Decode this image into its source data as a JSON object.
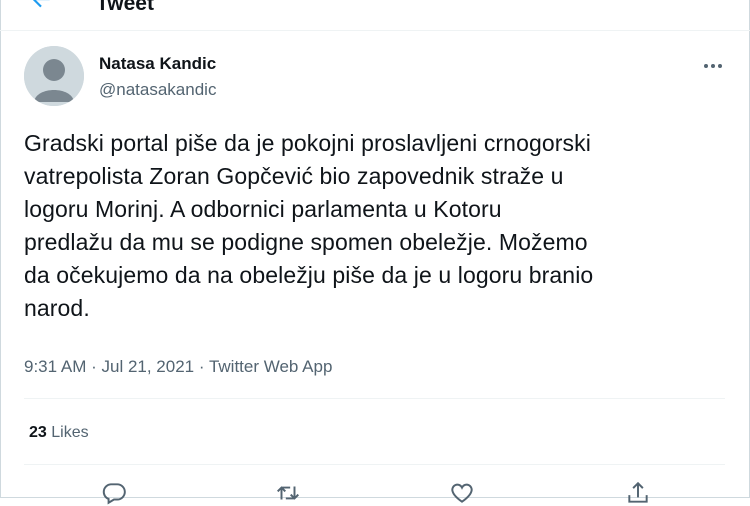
{
  "header": {
    "title": "Tweet"
  },
  "author": {
    "name": "Natasa Kandic",
    "handle": "@natasakandic"
  },
  "tweet": {
    "text": "Gradski portal piše da je pokojni proslavljeni crnogorski\nvatrepolista Zoran Gopčević bio zapovednik straže u\nlogoru Morinj. A odbornici parlamenta u Kotoru\npredlažu da mu se podigne spomen obeležje. Možemo\nda očekujemo da na obeležju piše da je u logoru branio\nnarod.",
    "time": "9:31 AM",
    "date": "Jul 21, 2021",
    "source": "Twitter Web App"
  },
  "stats": {
    "likes_count": "23",
    "likes_label": "Likes"
  },
  "colors": {
    "accent": "#1d9bf0",
    "text": "#0f1419",
    "secondary": "#536471"
  },
  "icons": [
    "back-arrow-icon",
    "more-icon",
    "reply-icon",
    "retweet-icon",
    "like-icon",
    "share-icon"
  ]
}
